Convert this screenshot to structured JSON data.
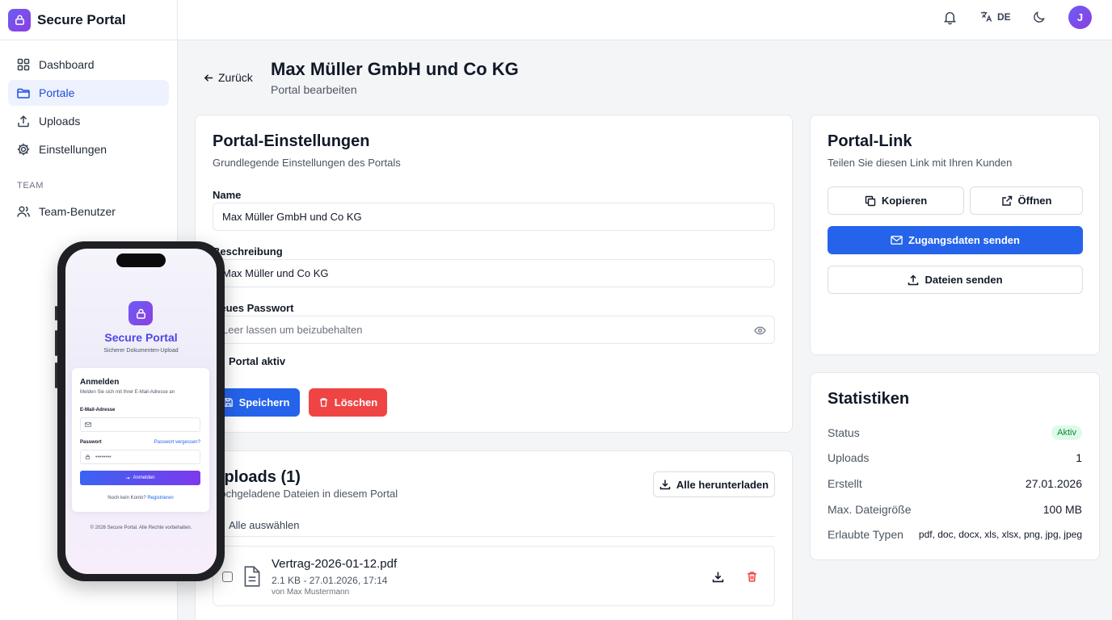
{
  "app": {
    "name": "Secure Portal"
  },
  "sidebar": {
    "items": [
      {
        "label": "Dashboard",
        "icon": "grid-icon",
        "active": false
      },
      {
        "label": "Portale",
        "icon": "folder-icon",
        "active": true
      },
      {
        "label": "Uploads",
        "icon": "upload-icon",
        "active": false
      },
      {
        "label": "Einstellungen",
        "icon": "gear-icon",
        "active": false
      }
    ],
    "section_label": "TEAM",
    "team_items": [
      {
        "label": "Team-Benutzer",
        "icon": "users-icon"
      }
    ]
  },
  "topbar": {
    "language": "DE",
    "avatar_initial": "J"
  },
  "header": {
    "back_label": "Zurück",
    "title": "Max Müller GmbH und Co KG",
    "subtitle": "Portal bearbeiten"
  },
  "settings": {
    "title": "Portal-Einstellungen",
    "subtitle": "Grundlegende Einstellungen des Portals",
    "name_label": "Name",
    "name_value": "Max Müller GmbH und Co KG",
    "desc_label": "Beschreibung",
    "desc_value": "Max Müller und Co KG",
    "password_label": "Neues Passwort",
    "password_placeholder": "Leer lassen um beizubehalten",
    "active_label": "Portal aktiv",
    "save_label": "Speichern",
    "delete_label": "Löschen"
  },
  "uploads": {
    "title": "Uploads (1)",
    "subtitle": "Hochgeladene Dateien in diesem Portal",
    "download_all_label": "Alle herunterladen",
    "select_all_label": "Alle auswählen",
    "files": [
      {
        "name": "Vertrag-2026-01-12.pdf",
        "meta": "2.1 KB - 27.01.2026, 17:14",
        "by": "von Max Mustermann"
      }
    ]
  },
  "portal_link": {
    "title": "Portal-Link",
    "subtitle": "Teilen Sie diesen Link mit Ihren Kunden",
    "copy_label": "Kopieren",
    "open_label": "Öffnen",
    "send_credentials_label": "Zugangsdaten senden",
    "send_files_label": "Dateien senden"
  },
  "stats": {
    "title": "Statistiken",
    "rows": [
      {
        "key": "Status",
        "value": "Aktiv"
      },
      {
        "key": "Uploads",
        "value": "1"
      },
      {
        "key": "Erstellt",
        "value": "27.01.2026"
      },
      {
        "key": "Max. Dateigröße",
        "value": "100 MB"
      },
      {
        "key": "Erlaubte Typen",
        "value": "pdf, doc, docx, xls, xlsx, png, jpg, jpeg"
      }
    ]
  },
  "phone": {
    "title": "Secure Portal",
    "subtitle": "Sicherer Dokumenten-Upload",
    "login_title": "Anmelden",
    "login_subtitle": "Melden Sie sich mit Ihrer E-Mail-Adresse an",
    "email_label": "E-Mail-Adresse",
    "password_label": "Passwort",
    "forgot_label": "Passwort vergessen?",
    "password_dots": "••••••••",
    "login_button": "Anmelden",
    "no_account": "Noch kein Konto?",
    "register": "Registrieren",
    "footer": "© 2026 Secure Portal. Alle Rechte vorbehalten."
  },
  "colors": {
    "primary": "#2563eb",
    "danger": "#ef4444",
    "brand": "#6d5cf6",
    "success_bg": "#dcfce7"
  }
}
